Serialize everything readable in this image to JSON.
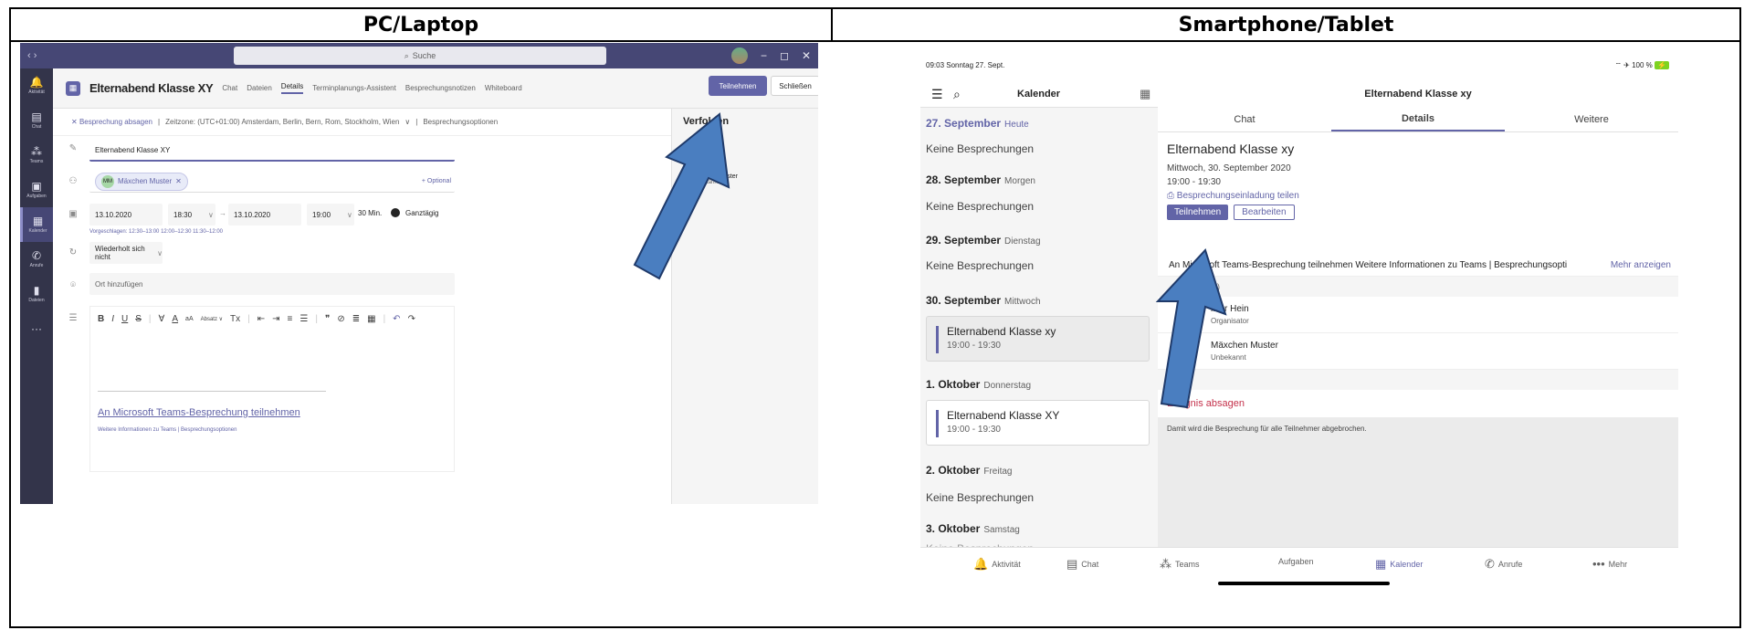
{
  "headers": {
    "left": "PC/Laptop",
    "right": "Smartphone/Tablet"
  },
  "colors": {
    "brand": "#6264a7",
    "arrow_fill": "#4a7ec0",
    "arrow_stroke": "#1f3a6a",
    "danger": "#c4314b"
  },
  "pc": {
    "search_placeholder": "Suche",
    "window_controls": [
      "−",
      "◻",
      "✕"
    ],
    "rail": [
      {
        "icon": "bell-icon",
        "glyph": "🔔",
        "label": "Aktivität"
      },
      {
        "icon": "chat-icon",
        "glyph": "▤",
        "label": "Chat"
      },
      {
        "icon": "teams-icon",
        "glyph": "⁂",
        "label": "Teams"
      },
      {
        "icon": "tasks-icon",
        "glyph": "▣",
        "label": "Aufgaben"
      },
      {
        "icon": "calendar-icon",
        "glyph": "▦",
        "label": "Kalender"
      },
      {
        "icon": "phone-icon",
        "glyph": "✆",
        "label": "Anrufe"
      },
      {
        "icon": "files-icon",
        "glyph": "▮",
        "label": "Dateien"
      },
      {
        "icon": "more-icon",
        "glyph": "···",
        "label": ""
      }
    ],
    "title": "Elternabend Klasse XY",
    "tabs": [
      "Chat",
      "Dateien",
      "Details",
      "Terminplanungs-Assistent",
      "Besprechungsnotizen",
      "Whiteboard"
    ],
    "active_tab": "Details",
    "join_label": "Teilnehmen",
    "close_label": "Schließen",
    "cancel_meeting": "Besprechung absagen",
    "timezone": "Zeitzone: (UTC+01:00) Amsterdam, Berlin, Bern, Rom, Stockholm, Wien",
    "meeting_options": "Besprechungsoptionen",
    "title_value": "Elternabend Klasse XY",
    "attendee_initials": "MM",
    "attendee_name": "Mäxchen Muster",
    "optional_label": "+ Optional",
    "start_date": "13.10.2020",
    "start_time": "18:30",
    "end_date": "13.10.2020",
    "end_time": "19:00",
    "duration": "30 Min.",
    "allday_label": "Ganztägig",
    "suggested": "Vorgeschlagen: 12:30–13:00  12:00–12:30  11:30–12:00",
    "repeat": "Wiederholt sich nicht",
    "location_placeholder": "Ort hinzufügen",
    "editor_tools": [
      "B",
      "I",
      "U",
      "S",
      "|",
      "∀",
      "A",
      "aA",
      "Absatz ∨",
      "Tx",
      "|",
      "⇤",
      "⇥",
      "≡",
      "☰",
      "|",
      "❞",
      "⊘",
      "≣",
      "▦",
      "|",
      "↶",
      "↷"
    ],
    "teams_link": "An Microsoft Teams-Besprechung teilnehmen",
    "teams_small": "Weitere Informationen zu Teams | Besprechungsoptionen",
    "side_header": "Verfolgen",
    "side_organizer": "in",
    "side_attendee": "xchen Muster",
    "side_attendee_status": "bekannt"
  },
  "tablet": {
    "status_left": "09:03  Sonntag 27. Sept.",
    "status_right": "100 %",
    "calendar_title": "Kalender",
    "days": [
      {
        "date": "27. September",
        "sub": "Heute",
        "today": true,
        "none": "Keine Besprechungen"
      },
      {
        "date": "28. September",
        "sub": "Morgen",
        "none": "Keine Besprechungen"
      },
      {
        "date": "29. September",
        "sub": "Dienstag",
        "none": "Keine Besprechungen"
      },
      {
        "date": "30. September",
        "sub": "Mittwoch",
        "event_title": "Elternabend Klasse xy",
        "event_time": "19:00 - 19:30"
      },
      {
        "date": "1. Oktober",
        "sub": "Donnerstag",
        "event_title": "Elternabend Klasse XY",
        "event_time": "19:00 - 19:30"
      },
      {
        "date": "2. Oktober",
        "sub": "Freitag",
        "none": "Keine Besprechungen"
      },
      {
        "date": "3. Oktober",
        "sub": "Samstag",
        "none": "Keine Besprechungen"
      }
    ],
    "detail_header": "Elternabend Klasse xy",
    "tabs": [
      "Chat",
      "Details",
      "Weitere"
    ],
    "title": "Elternabend Klasse xy",
    "date": "Mittwoch, 30. September 2020",
    "time": "19:00 - 19:30",
    "share": "⎙ Besprechungseinladung teilen",
    "join": "Teilnehmen",
    "edit": "Bearbeiten",
    "invite_text": "An Microsoft Teams-Besprechung teilnehmen Weitere Informationen zu Teams | Besprechungsopti",
    "more": "Mehr anzeigen",
    "participants_label": "2)",
    "participants": [
      {
        "name": "liver Hein",
        "role": "Organisator"
      },
      {
        "name": "Mäxchen Muster",
        "role": "Unbekannt"
      }
    ],
    "cancel_event": "Ereignis absagen",
    "cancel_note": "Damit wird die Besprechung für alle Teilnehmer abgebrochen.",
    "nav": [
      {
        "icon": "bell-icon",
        "glyph": "🔔",
        "label": "Aktivität"
      },
      {
        "icon": "chat-icon",
        "glyph": "▤",
        "label": "Chat"
      },
      {
        "icon": "teams-icon",
        "glyph": "⁂",
        "label": "Teams"
      },
      {
        "icon": "tasks-icon",
        "glyph": "",
        "label": "Aufgaben"
      },
      {
        "icon": "calendar-icon",
        "glyph": "▦",
        "label": "Kalender",
        "active": true
      },
      {
        "icon": "phone-icon",
        "glyph": "✆",
        "label": "Anrufe"
      },
      {
        "icon": "more-icon",
        "glyph": "•••",
        "label": "Mehr"
      }
    ]
  }
}
